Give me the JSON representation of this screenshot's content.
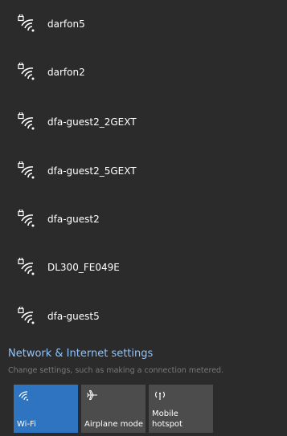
{
  "networks": [
    {
      "ssid": "darfon5",
      "icon": "wifi-secured-icon"
    },
    {
      "ssid": "darfon2",
      "icon": "wifi-secured-icon"
    },
    {
      "ssid": "dfa-guest2_2GEXT",
      "icon": "wifi-secured-icon"
    },
    {
      "ssid": "dfa-guest2_5GEXT",
      "icon": "wifi-secured-icon"
    },
    {
      "ssid": "dfa-guest2",
      "icon": "wifi-secured-icon"
    },
    {
      "ssid": "DL300_FE049E",
      "icon": "wifi-secured-icon"
    },
    {
      "ssid": "dfa-guest5",
      "icon": "wifi-secured-icon"
    }
  ],
  "settings": {
    "link_label": "Network & Internet settings",
    "description": "Change settings, such as making a connection metered."
  },
  "quick_actions": {
    "wifi": {
      "label": "Wi-Fi",
      "icon": "wifi-icon",
      "active": true
    },
    "airplane": {
      "label": "Airplane mode",
      "icon": "airplane-icon",
      "active": false
    },
    "hotspot": {
      "label_line1": "Mobile",
      "label_line2": "hotspot",
      "icon": "hotspot-icon",
      "active": false
    }
  },
  "colors": {
    "background": "#2b2b2b",
    "accent": "#2f74c0",
    "tile": "#4c4c4c",
    "link": "#8fc4ff",
    "muted": "#7a7a7a"
  }
}
